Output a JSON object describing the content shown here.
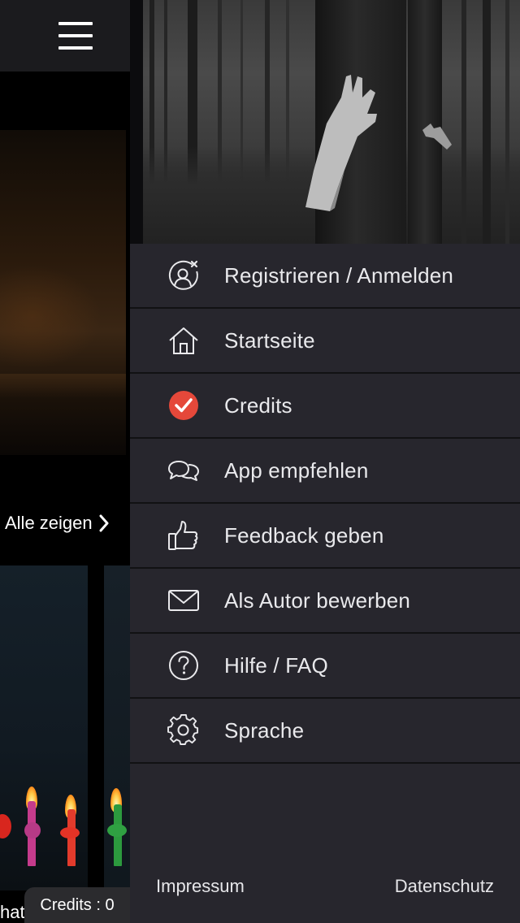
{
  "menu": {
    "items": [
      {
        "label": "Registrieren / Anmelden",
        "icon": "user-remove-icon"
      },
      {
        "label": "Startseite",
        "icon": "home-icon"
      },
      {
        "label": "Credits",
        "icon": "checkmark-circle-icon"
      },
      {
        "label": "App empfehlen",
        "icon": "chat-bubbles-icon"
      },
      {
        "label": "Feedback geben",
        "icon": "thumbs-up-icon"
      },
      {
        "label": "Als Autor bewerben",
        "icon": "envelope-icon"
      },
      {
        "label": "Hilfe / FAQ",
        "icon": "question-circle-icon"
      },
      {
        "label": "Sprache",
        "icon": "gear-icon"
      }
    ],
    "footer": {
      "left": "Impressum",
      "right": "Datenschutz"
    }
  },
  "background": {
    "show_all": "Alle zeigen",
    "truncated_title": "hat",
    "credits_badge": "Credits : 0"
  },
  "colors": {
    "drawer_bg": "#27262d",
    "divider": "#111113",
    "accent_red": "#e5483a",
    "text": "#e9e9ec"
  }
}
